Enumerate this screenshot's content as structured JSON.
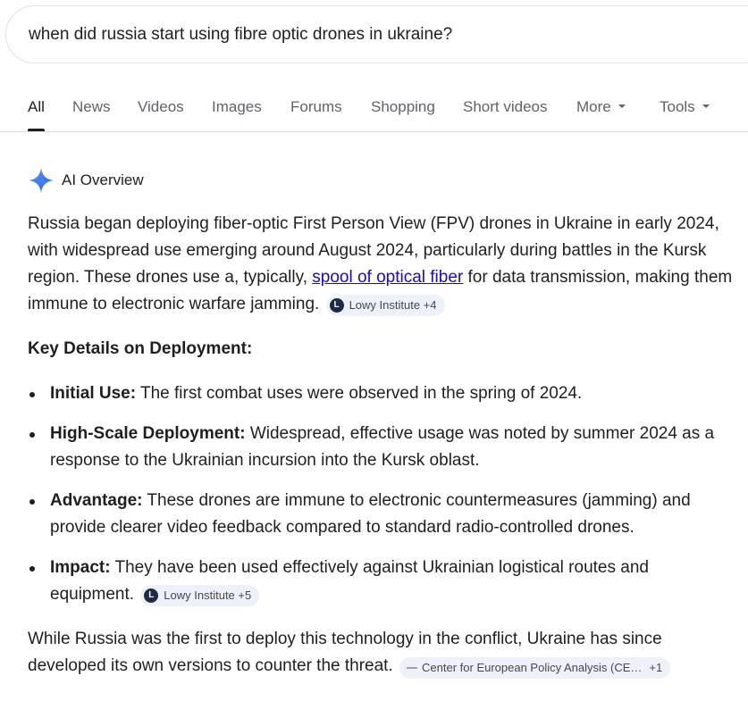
{
  "search": {
    "query": "when did russia start using fibre optic drones in ukraine?"
  },
  "tabs": [
    {
      "label": "All",
      "active": true
    },
    {
      "label": "News"
    },
    {
      "label": "Videos"
    },
    {
      "label": "Images"
    },
    {
      "label": "Forums"
    },
    {
      "label": "Shopping"
    },
    {
      "label": "Short videos"
    },
    {
      "label": "More"
    },
    {
      "label": "Tools"
    }
  ],
  "ai_overview": {
    "title": "AI Overview",
    "intro": {
      "before_link": "Russia began deploying fiber-optic First Person View (FPV) drones in Ukraine in early 2024, with widespread use emerging around August 2024, particularly during battles in the Kursk region. These drones use a, typically, ",
      "link_text": "spool of optical fiber",
      "after_link": " for data transmission, making them immune to electronic warfare jamming.",
      "source_chip": {
        "logo": "L",
        "label": "Lowy Institute +4"
      }
    },
    "heading": "Key Details on Deployment:",
    "bullets": [
      {
        "label": "Initial Use:",
        "text": " The first combat uses were observed in the spring of 2024."
      },
      {
        "label": "High-Scale Deployment:",
        "text": " Widespread, effective usage was noted by summer 2024 as a response to the Ukrainian incursion into the Kursk oblast."
      },
      {
        "label": "Advantage:",
        "text": " These drones are immune to electronic countermeasures (jamming) and provide clearer video feedback compared to standard radio-controlled drones."
      },
      {
        "label": "Impact:",
        "text": " They have been used effectively against Ukrainian logistical routes and equipment.",
        "source_chip": {
          "logo": "L",
          "label": "Lowy Institute +5"
        }
      }
    ],
    "closing": {
      "text": "While Russia was the first to deploy this technology in the conflict, Ukraine has since developed its own versions to counter the threat.",
      "source_chip": {
        "label": "Center for European Policy Analysis (CE…",
        "more": "+1"
      }
    }
  },
  "colors": {
    "accent_link": "#1a0dab",
    "chip_bg": "#edf2fa",
    "sparkle_blue": "#4285f4"
  }
}
